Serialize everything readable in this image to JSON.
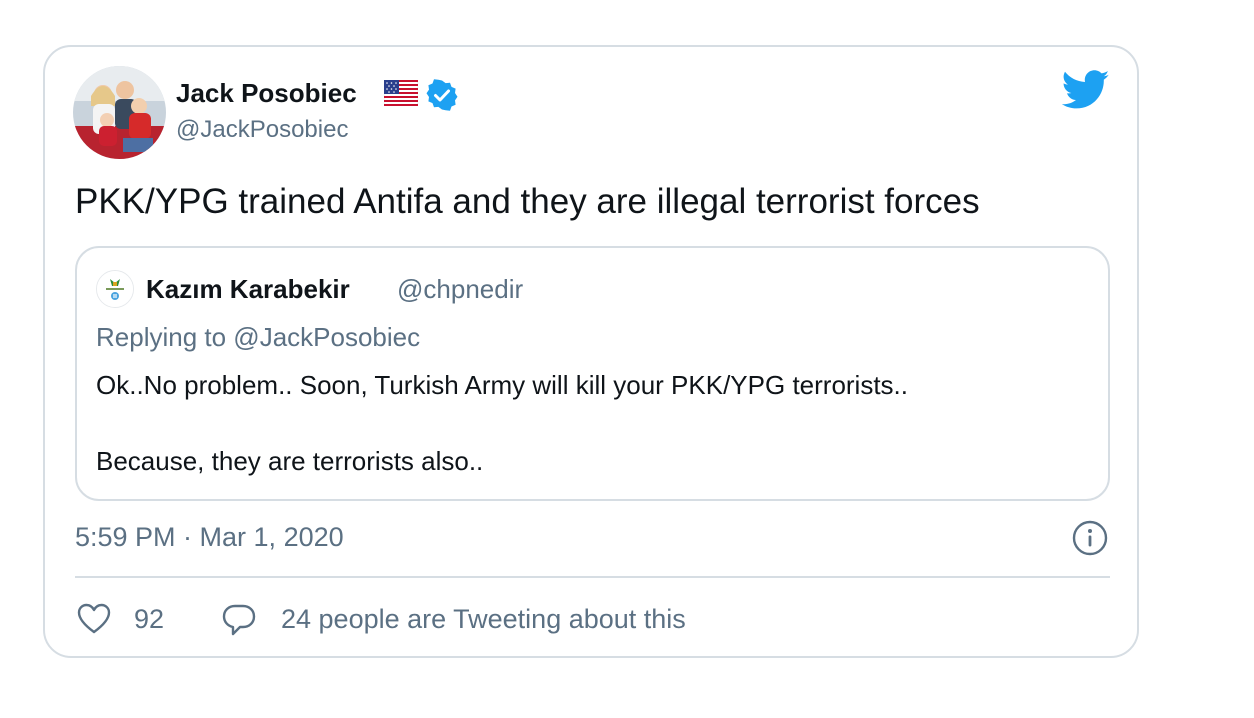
{
  "tweet": {
    "author_name": "Jack Posobiec",
    "author_handle": "@JackPosobiec",
    "text": "PKK/YPG trained Antifa and they are illegal terrorist forces",
    "timestamp": "5:59 PM · Mar 1, 2020",
    "like_count": "92",
    "tweeting_text": "24 people are Tweeting about this"
  },
  "quoted": {
    "author_name": "Kazım Karabekir",
    "author_handle": "@chpnedir",
    "replying_to": "Replying to @JackPosobiec",
    "lines": [
      "Ok..No problem.. Soon, Turkish Army will kill your PKK/YPG terrorists..",
      "Because, they are terrorists also.."
    ]
  },
  "icons": {
    "flag": "us-flag-icon",
    "verified": "verified-badge-icon",
    "brand": "twitter-bird-icon",
    "info": "info-icon",
    "like": "heart-icon",
    "reply": "reply-bubble-icon"
  },
  "colors": {
    "twitter_blue": "#1da1f2",
    "secondary_text": "#5b7083",
    "border": "#d6dde3"
  }
}
